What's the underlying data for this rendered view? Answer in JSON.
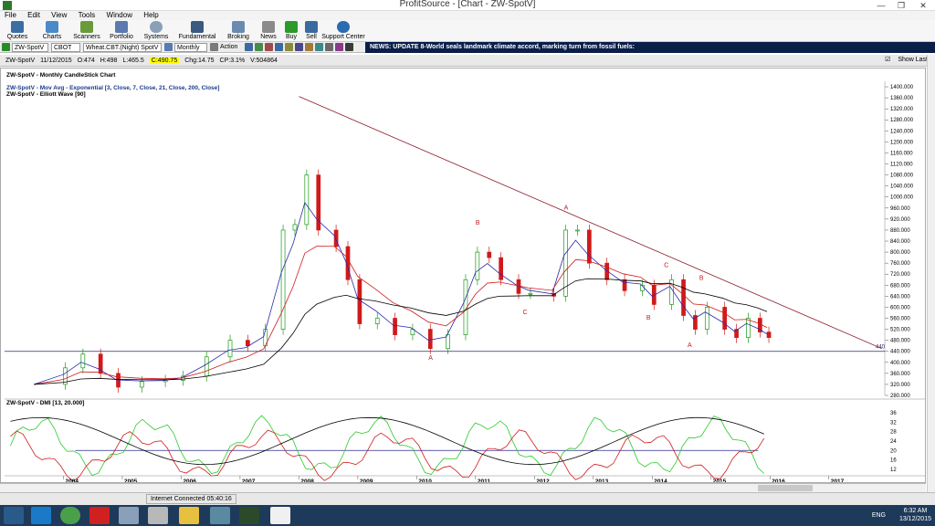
{
  "window": {
    "title": "ProfitSource - [Chart - ZW-SpotV]"
  },
  "menu": [
    "File",
    "Edit",
    "View",
    "Tools",
    "Window",
    "Help"
  ],
  "toolbar": [
    "Quotes",
    "Charts",
    "Scanners",
    "Portfolio",
    "Systems",
    "Fundamental",
    "Broking",
    "News",
    "Buy",
    "Sell",
    "Support Center"
  ],
  "symbolbar": {
    "symbol": "ZW-SpotV",
    "exchange": "CBOT",
    "desc": "Wheat.CBT.(Night) SpotV",
    "period": "Monthly",
    "action": "Action",
    "news": "NEWS: UPDATE 8-World seals landmark climate accord, marking turn from fossil fuels:"
  },
  "quote": {
    "symbol": "ZW-SpotV",
    "date": "11/12/2015",
    "open": "O:474",
    "high": "H:498",
    "low": "L:465.5",
    "close": "C:490.75",
    "chg": "Chg:14.75",
    "cp": "CP:3.1%",
    "vol": "V:504864",
    "show_last": "Show Last"
  },
  "legend": {
    "line1": "ZW-SpotV - Monthly CandleStick Chart",
    "line2": "ZW-SpotV - Mov Avg - Exponential [3, Close, 7, Close, 21, Close, 200, Close]",
    "line3": "ZW-SpotV - Elliott Wave [90]",
    "dmi": "ZW-SpotV - DMI [13, 20.000]"
  },
  "chart_data": {
    "type": "candlestick",
    "x_labels": [
      "2004",
      "2005",
      "2006",
      "2007",
      "2008",
      "2009",
      "2010",
      "2011",
      "2012",
      "2013",
      "2014",
      "2015",
      "2016",
      "2017"
    ],
    "y_ticks": [
      280,
      320,
      360,
      400,
      440,
      480,
      520,
      560,
      600,
      640,
      680,
      720,
      760,
      800,
      840,
      880,
      920,
      960,
      1000,
      1040,
      1080,
      1120,
      1160,
      1200,
      1240,
      1280,
      1320,
      1360,
      1400
    ],
    "ylim": [
      280,
      1420
    ],
    "support_level": 440,
    "support_label": "440",
    "trendline": {
      "from": [
        "2008",
        1365
      ],
      "to": [
        "2017.9",
        450
      ]
    },
    "wave_labels": [
      {
        "text": "A",
        "x": "2010.2",
        "y": 410
      },
      {
        "text": "B",
        "x": "2011.0",
        "y": 900
      },
      {
        "text": "C",
        "x": "2011.8",
        "y": 575
      },
      {
        "text": "A",
        "x": "2012.5",
        "y": 955
      },
      {
        "text": "B",
        "x": "2013.9",
        "y": 555
      },
      {
        "text": "C",
        "x": "2014.2",
        "y": 745
      },
      {
        "text": "A",
        "x": "2014.6",
        "y": 455
      },
      {
        "text": "B",
        "x": "2014.8",
        "y": 700
      }
    ],
    "close_series": [
      [
        "2003.5",
        320
      ],
      [
        "2004.0",
        380
      ],
      [
        "2004.3",
        430
      ],
      [
        "2004.6",
        360
      ],
      [
        "2004.9",
        310
      ],
      [
        "2005.3",
        330
      ],
      [
        "2005.7",
        335
      ],
      [
        "2006.0",
        350
      ],
      [
        "2006.4",
        420
      ],
      [
        "2006.8",
        480
      ],
      [
        "2007.1",
        460
      ],
      [
        "2007.4",
        520
      ],
      [
        "2007.7",
        880
      ],
      [
        "2007.9",
        900
      ],
      [
        "2008.1",
        1080
      ],
      [
        "2008.3",
        880
      ],
      [
        "2008.6",
        820
      ],
      [
        "2008.8",
        700
      ],
      [
        "2009.0",
        540
      ],
      [
        "2009.3",
        560
      ],
      [
        "2009.6",
        500
      ],
      [
        "2009.9",
        520
      ],
      [
        "2010.2",
        450
      ],
      [
        "2010.5",
        500
      ],
      [
        "2010.8",
        700
      ],
      [
        "2011.0",
        800
      ],
      [
        "2011.2",
        780
      ],
      [
        "2011.4",
        700
      ],
      [
        "2011.7",
        650
      ],
      [
        "2011.9",
        650
      ],
      [
        "2012.3",
        640
      ],
      [
        "2012.5",
        880
      ],
      [
        "2012.7",
        880
      ],
      [
        "2012.9",
        760
      ],
      [
        "2013.2",
        700
      ],
      [
        "2013.5",
        660
      ],
      [
        "2013.8",
        680
      ],
      [
        "2014.0",
        610
      ],
      [
        "2014.3",
        700
      ],
      [
        "2014.5",
        570
      ],
      [
        "2014.7",
        520
      ],
      [
        "2014.9",
        600
      ],
      [
        "2015.2",
        520
      ],
      [
        "2015.4",
        490
      ],
      [
        "2015.6",
        560
      ],
      [
        "2015.8",
        510
      ],
      [
        "2015.95",
        490
      ]
    ],
    "dmi": {
      "yticks": [
        12,
        16,
        20,
        24,
        28,
        32,
        36
      ],
      "threshold": 20
    }
  },
  "status": {
    "connection": "Internet Connected 05:40:16"
  },
  "tray": {
    "lang": "ENG",
    "time": "6:32 AM",
    "date": "13/12/2015"
  }
}
